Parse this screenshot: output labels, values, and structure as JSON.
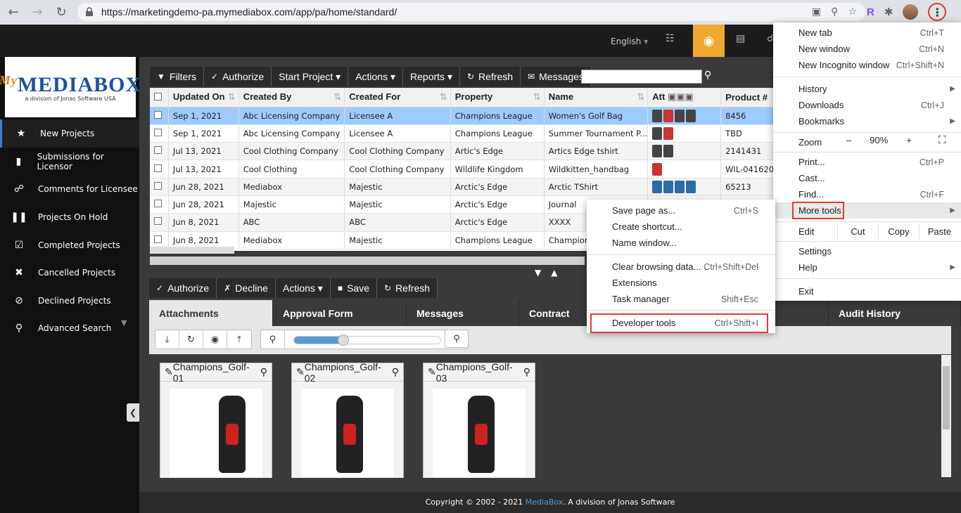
{
  "browser": {
    "url": "https://marketingdemo-pa.mymediabox.com/app/pa/home/standard/",
    "extension_letter": "R"
  },
  "header": {
    "language": "English",
    "language_caret": "▾"
  },
  "logo": {
    "my": "My",
    "main": "MEDIABOX",
    "sub": "a division of Jonas Software USA"
  },
  "sidebar": {
    "items": [
      {
        "label": "New Projects",
        "icon": "star-icon"
      },
      {
        "label": "Submissions for Licensor",
        "icon": "folder-icon"
      },
      {
        "label": "Comments for Licensee",
        "icon": "comments-icon"
      },
      {
        "label": "Projects On Hold",
        "icon": "pause-icon"
      },
      {
        "label": "Completed Projects",
        "icon": "check-square-icon"
      },
      {
        "label": "Cancelled Projects",
        "icon": "x-icon"
      },
      {
        "label": "Declined Projects",
        "icon": "ban-icon"
      },
      {
        "label": "Advanced Search",
        "icon": "search-icon"
      }
    ]
  },
  "toolbar": {
    "filters": "Filters",
    "authorize": "Authorize",
    "start_project": "Start Project",
    "actions": "Actions",
    "reports": "Reports",
    "refresh": "Refresh",
    "messages": "Messages"
  },
  "table": {
    "headers": [
      "Updated On",
      "Created By",
      "Created For",
      "Property",
      "Name",
      "Att",
      "Product #"
    ],
    "rows": [
      [
        "Sep 1, 2021",
        "Abc Licensing Company",
        "Licensee A",
        "Champions League",
        "Women's Golf Bag",
        "",
        "8456"
      ],
      [
        "Sep 1, 2021",
        "Abc Licensing Company",
        "Licensee A",
        "Champions League",
        "Summer Tournament P...",
        "",
        "TBD"
      ],
      [
        "Jul 13, 2021",
        "Cool Clothing Company",
        "Cool Clothing Company",
        "Artic's Edge",
        "Artics Edge tshirt",
        "",
        "2141431"
      ],
      [
        "Jul 13, 2021",
        "Cool Clothing",
        "Cool Clothing Company",
        "Wildlife Kingdom",
        "Wildkitten_handbag",
        "",
        "WIL-041620"
      ],
      [
        "Jun 28, 2021",
        "Mediabox",
        "Majestic",
        "Arctic's Edge",
        "Arctic TShirt",
        "",
        "65213"
      ],
      [
        "Jun 28, 2021",
        "Majestic",
        "Majestic",
        "Arctic's Edge",
        "Journal",
        "",
        ""
      ],
      [
        "Jun 8, 2021",
        "ABC",
        "ABC",
        "Arctic's Edge",
        "XXXX",
        "",
        ""
      ],
      [
        "Jun 8, 2021",
        "Mediabox",
        "Majestic",
        "Champions League",
        "Champior",
        "",
        ""
      ]
    ]
  },
  "bottom_toolbar": {
    "authorize": "Authorize",
    "decline": "Decline",
    "actions": "Actions",
    "save": "Save",
    "refresh": "Refresh"
  },
  "tabs": [
    "Attachments",
    "Approval Form",
    "Messages",
    "Contract",
    "Audit History"
  ],
  "cards": [
    {
      "title": "Champions_Golf-01"
    },
    {
      "title": "Champions_Golf-02"
    },
    {
      "title": "Champions_Golf-03"
    }
  ],
  "footer": {
    "prefix": "Copyright © 2002 - 2021 ",
    "brand": "MediaBox",
    "suffix": ". A division of Jonas Software"
  },
  "chrome_menu": {
    "new_tab": "New tab",
    "new_tab_sc": "Ctrl+T",
    "new_window": "New window",
    "new_window_sc": "Ctrl+N",
    "incognito": "New Incognito window",
    "incognito_sc": "Ctrl+Shift+N",
    "history": "History",
    "downloads": "Downloads",
    "downloads_sc": "Ctrl+J",
    "bookmarks": "Bookmarks",
    "zoom": "Zoom",
    "zoom_minus": "–",
    "zoom_value": "90%",
    "zoom_plus": "+",
    "print": "Print...",
    "print_sc": "Ctrl+P",
    "cast": "Cast...",
    "find": "Find...",
    "find_sc": "Ctrl+F",
    "more_tools": "More tools",
    "edit": "Edit",
    "cut": "Cut",
    "copy": "Copy",
    "paste": "Paste",
    "settings": "Settings",
    "help": "Help",
    "exit": "Exit"
  },
  "more_tools_menu": {
    "save_page": "Save page as...",
    "save_page_sc": "Ctrl+S",
    "create_shortcut": "Create shortcut...",
    "name_window": "Name window...",
    "clear_data": "Clear browsing data...",
    "clear_data_sc": "Ctrl+Shift+Del",
    "extensions": "Extensions",
    "task_manager": "Task manager",
    "task_manager_sc": "Shift+Esc",
    "dev_tools": "Developer tools",
    "dev_tools_sc": "Ctrl+Shift+I"
  },
  "highlight_color": "#e53935",
  "accent_orange": "#f0a830"
}
